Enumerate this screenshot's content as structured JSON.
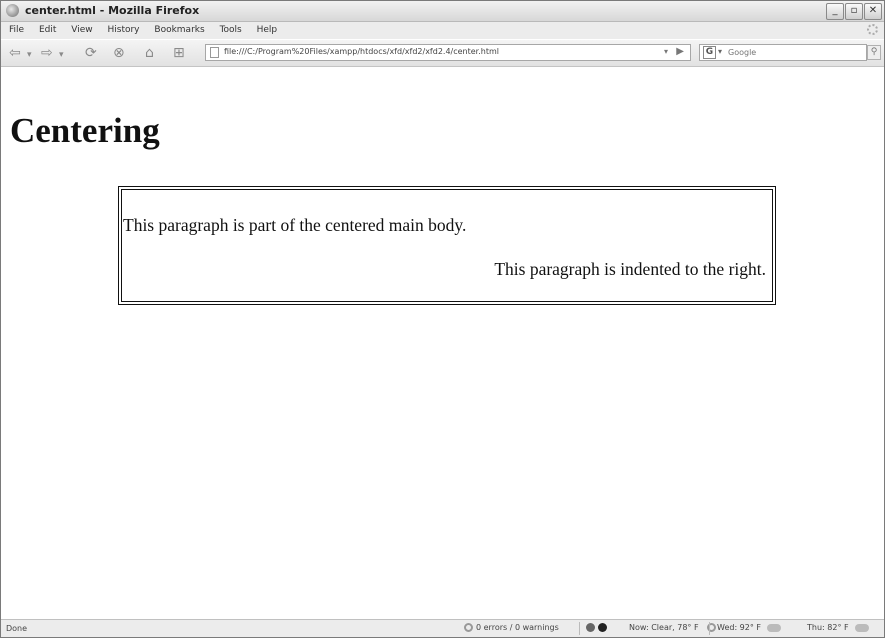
{
  "window": {
    "title": "center.html - Mozilla Firefox",
    "minimize": "_",
    "maximize": "▫",
    "close": "✕"
  },
  "menu": [
    "File",
    "Edit",
    "View",
    "History",
    "Bookmarks",
    "Tools",
    "Help"
  ],
  "navbar": {
    "url": "file:///C:/Program%20Files/xampp/htdocs/xfd/xfd2/xfd2.4/center.html",
    "search_engine_letter": "G",
    "search_placeholder": "Google"
  },
  "page": {
    "heading": "Centering",
    "paragraph_main": "This paragraph is part of the centered main body.",
    "paragraph_right": "This paragraph is indented to the right."
  },
  "status": {
    "text": "Done",
    "errors": "0 errors / 0 warnings",
    "weather_now": "Now: Clear, 78° F",
    "weather_wed": "Wed: 92° F",
    "weather_thu": "Thu: 82° F"
  }
}
